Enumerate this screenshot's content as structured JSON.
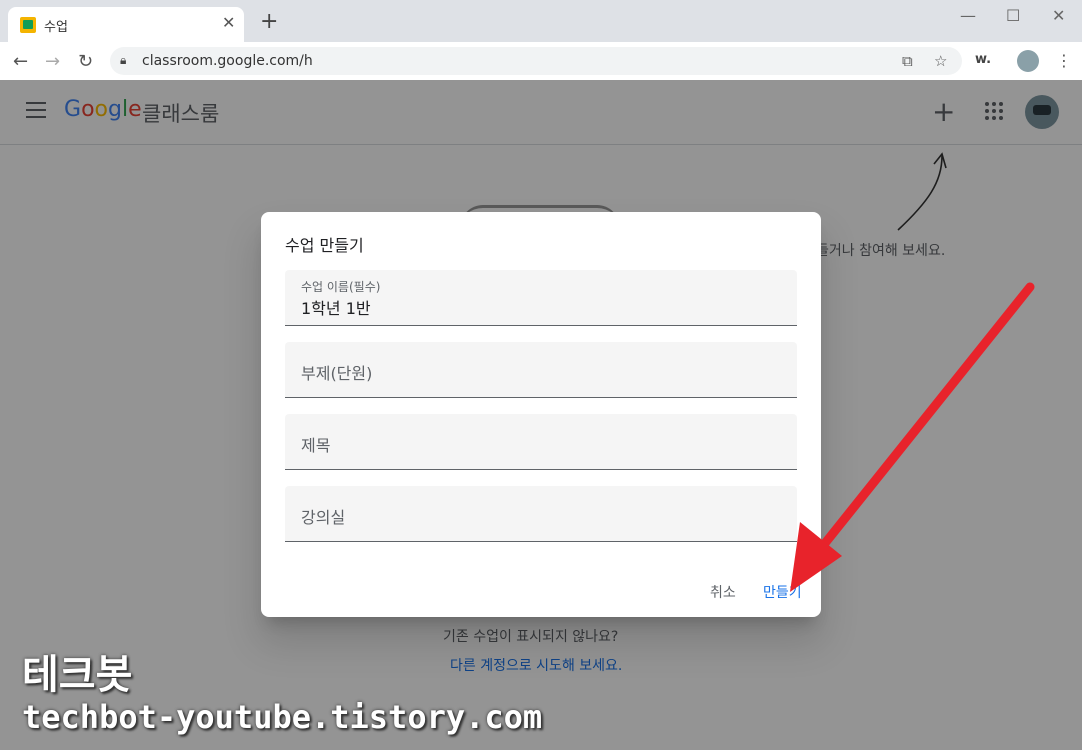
{
  "browser": {
    "tab_title": "수업",
    "tab_close": "✕",
    "new_tab": "+",
    "url": "classroom.google.com/h",
    "extension_label": "w.",
    "window_controls": {
      "minimize": "—",
      "maximize": "☐",
      "close": "✕"
    }
  },
  "app": {
    "logo_text": "Google",
    "app_name": "클래스룸",
    "plus": "+",
    "hint_text": "들거나 참여해 보세요.",
    "bottom_question": "기존 수업이 표시되지 않나요?",
    "bottom_link": "다른 계정으로 시도해 보세요."
  },
  "dialog": {
    "title": "수업 만들기",
    "fields": [
      {
        "label": "수업 이름(필수)",
        "value": "1학년 1반"
      },
      {
        "placeholder": "부제(단원)"
      },
      {
        "placeholder": "제목"
      },
      {
        "placeholder": "강의실"
      }
    ],
    "cancel_label": "취소",
    "create_label": "만들기"
  },
  "watermark": {
    "line1": "테크봇",
    "line2": "techbot-youtube.tistory.com"
  },
  "colors": {
    "accent": "#1a73e8",
    "annotation_arrow": "#e8232b"
  }
}
